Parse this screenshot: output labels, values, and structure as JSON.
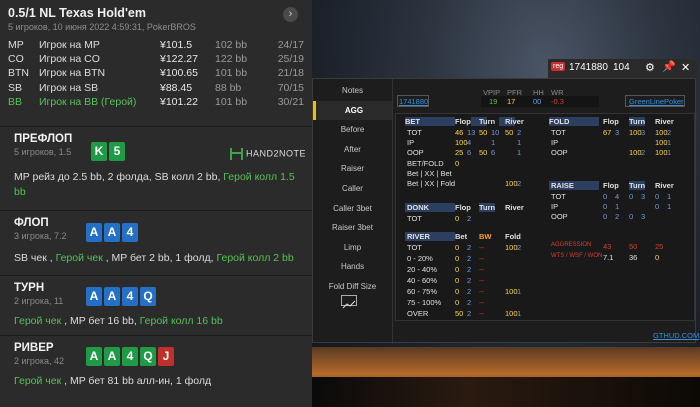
{
  "header": {
    "title": "0.5/1 NL Texas Hold'em",
    "subtitle": "5 игроков, 10 июня 2022 4:59:31, PokerBROS",
    "close_icon": "chevron-right-icon"
  },
  "players": [
    {
      "pos": "MP",
      "name": "Игрок на MP",
      "amount": "¥101.5",
      "bb": "102 bb",
      "stat": "24/17",
      "hero": false
    },
    {
      "pos": "CO",
      "name": "Игрок на CO",
      "amount": "¥122.27",
      "bb": "122 bb",
      "stat": "25/19",
      "hero": false
    },
    {
      "pos": "BTN",
      "name": "Игрок на BTN",
      "amount": "¥100.65",
      "bb": "101 bb",
      "stat": "21/18",
      "hero": false
    },
    {
      "pos": "SB",
      "name": "Игрок на SB",
      "amount": "¥88.45",
      "bb": "88 bb",
      "stat": "70/15",
      "hero": false
    },
    {
      "pos": "BB",
      "name": "Игрок на BB (Герой)",
      "amount": "¥101.22",
      "bb": "101 bb",
      "stat": "30/21",
      "hero": true
    }
  ],
  "streets": {
    "preflop": {
      "title": "ПРЕФЛОП",
      "sub": "5 игроков, 1.5",
      "cards": [
        "K",
        "5"
      ],
      "a1": "MP",
      "a2": " рейз до 2.5 bb, 2 фолда, SB колл 2 bb, ",
      "a3": "Герой колл 1.5",
      "a4": "bb"
    },
    "flop": {
      "title": "ФЛОП",
      "sub": "3 игрока, 7.2",
      "cards": [
        "A",
        "A",
        "4"
      ],
      "a1": "SB",
      "a2": " чек , ",
      "a3": "Герой чек",
      "a4": " , MP бет 2 bb, 1 фолд, ",
      "a5": "Герой колл 2 bb"
    },
    "turn": {
      "title": "ТУРН",
      "sub": "2 игрока, 11",
      "cards": [
        "A",
        "A",
        "4",
        "Q"
      ],
      "a1": "Герой чек",
      "a2": " , MP бет 16 bb, ",
      "a3": "Герой колл 16 bb"
    },
    "river": {
      "title": "РИВЕР",
      "sub": "2 игрока, 42",
      "cards": [
        "A",
        "A",
        "4",
        "Q",
        "J"
      ],
      "a1": "Герой чек",
      "a2": " , MP бет 81 bb алл-ин, 1 фолд"
    }
  },
  "brand": "HAND2NOTE",
  "hud": {
    "player_id": "1741880",
    "hands": "104",
    "reg": "reg",
    "tab_id": "1741880",
    "site": "GreenLinePoker",
    "footer": "GTHUD.COM",
    "top_stats": {
      "labels": [
        "VPIP",
        "PFR",
        "HH",
        "WR"
      ],
      "values": [
        "19",
        "17",
        "00",
        "-0.3"
      ]
    },
    "nav": [
      "Notes",
      "AGG",
      "Before",
      "After",
      "Raiser",
      "Caller",
      "Caller 3bet",
      "Raiser 3bet",
      "Limp",
      "Hands",
      "Fold Diff Size"
    ],
    "chart_icon": "line-chart-icon",
    "bet": {
      "h": [
        "BET",
        "Flop",
        "Turn",
        "River"
      ],
      "rows": [
        [
          "TOT",
          "46",
          "13",
          "50",
          "10",
          "50",
          "2"
        ],
        [
          "IP",
          "100",
          "4",
          "",
          "1",
          "",
          "1"
        ],
        [
          "OOP",
          "25",
          "6",
          "50",
          "6",
          "",
          "1"
        ]
      ],
      "extra": [
        "BET/FOLD",
        "Bet | XX | Bet",
        "Bet | XX | Fold"
      ],
      "betfold": [
        "0",
        "",
        "",
        "",
        "",
        ""
      ],
      "bxf": "100",
      "bxf2": "2"
    },
    "fold": {
      "h": [
        "FOLD",
        "Flop",
        "Turn",
        "River"
      ],
      "rows": [
        [
          "TOT",
          "67",
          "3",
          "100",
          "3",
          "100",
          "2"
        ],
        [
          "IP",
          "",
          "",
          "",
          "",
          "100",
          "1"
        ],
        [
          "OOP",
          "",
          "",
          "100",
          "2",
          "100",
          "1"
        ]
      ]
    },
    "donk": {
      "h": [
        "DONK",
        "Flop",
        "Turn",
        "River"
      ],
      "rows": [
        [
          "TOT",
          "0",
          "2",
          "",
          ""
        ]
      ]
    },
    "raise": {
      "h": [
        "RAISE",
        "Flop",
        "Turn",
        "River"
      ],
      "rows": [
        [
          "TOT",
          "0",
          "4",
          "0",
          "3",
          "0",
          "1"
        ],
        [
          "IP",
          "0",
          "1",
          "",
          "",
          "0",
          "1"
        ],
        [
          "OOP",
          "0",
          "2",
          "0",
          "3",
          "",
          ""
        ]
      ]
    },
    "river": {
      "h": [
        "RIVER",
        "Bet",
        "BW",
        "Fold"
      ],
      "rows": [
        [
          "TOT",
          "0",
          "2",
          "--",
          "100",
          "2"
        ],
        [
          "0 - 20%",
          "0",
          "2",
          "--",
          "",
          ""
        ],
        [
          "20 - 40%",
          "0",
          "2",
          "--",
          "",
          ""
        ],
        [
          "40 - 60%",
          "0",
          "2",
          "--",
          "",
          ""
        ],
        [
          "60 - 75%",
          "0",
          "2",
          "--",
          "100",
          "1"
        ],
        [
          "75 - 100%",
          "0",
          "2",
          "--",
          "",
          ""
        ],
        [
          "OVER",
          "50",
          "2",
          "--",
          "100",
          "1"
        ]
      ]
    },
    "agg": [
      [
        "AGGRESSION",
        "43",
        "50",
        "25"
      ],
      [
        "WTS / WSF / WON",
        "7.1",
        "36",
        "0"
      ]
    ]
  },
  "colors": {
    "green": "#55c255",
    "card_green": "#1f9a45",
    "card_blue": "#2470c7",
    "card_red": "#c0302a",
    "yellow": "#ffd54a"
  }
}
